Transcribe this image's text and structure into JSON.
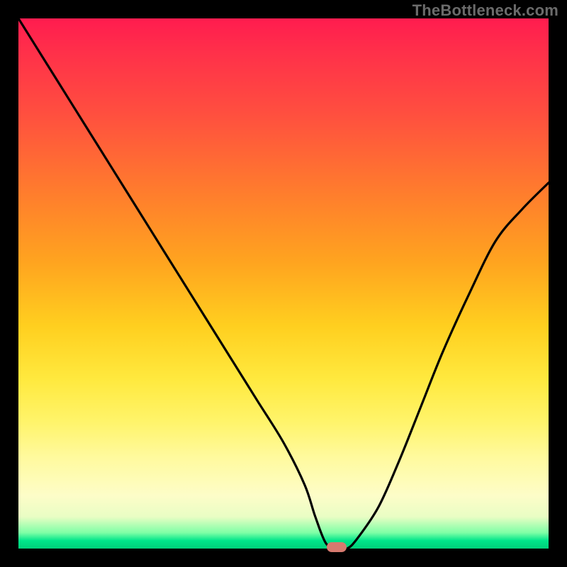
{
  "watermark": "TheBottleneck.com",
  "chart_data": {
    "type": "line",
    "title": "",
    "xlabel": "",
    "ylabel": "",
    "xlim": [
      0,
      100
    ],
    "ylim": [
      0,
      100
    ],
    "grid": false,
    "legend": false,
    "x": [
      0,
      5,
      10,
      15,
      20,
      25,
      30,
      35,
      40,
      45,
      50,
      54,
      56,
      58,
      60,
      62,
      64,
      68,
      72,
      76,
      80,
      85,
      90,
      95,
      100
    ],
    "values": [
      100,
      92,
      84,
      76,
      68,
      60,
      52,
      44,
      36,
      28,
      20,
      12,
      6,
      1,
      0,
      0,
      2,
      8,
      17,
      27,
      37,
      48,
      58,
      64,
      69
    ],
    "marker": {
      "x": 60,
      "y": 0
    },
    "gradient_colors": [
      "#ff1c4f",
      "#ff7a2e",
      "#ffe93e",
      "#fdfdc8",
      "#00d07a"
    ]
  }
}
